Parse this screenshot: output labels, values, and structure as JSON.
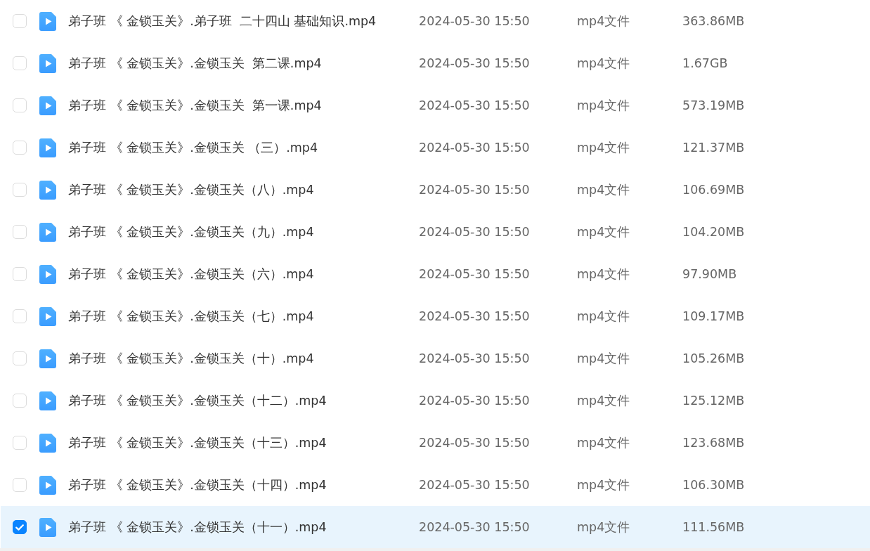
{
  "file_list": {
    "rows": [
      {
        "name": "弟子班 《 金锁玉关》.弟子班  二十四山 基础知识.mp4",
        "modified": "2024-05-30 15:50",
        "type": "mp4文件",
        "size": "363.86MB",
        "selected": false
      },
      {
        "name": "弟子班 《 金锁玉关》.金锁玉关  第二课.mp4",
        "modified": "2024-05-30 15:50",
        "type": "mp4文件",
        "size": "1.67GB",
        "selected": false
      },
      {
        "name": "弟子班 《 金锁玉关》.金锁玉关  第一课.mp4",
        "modified": "2024-05-30 15:50",
        "type": "mp4文件",
        "size": "573.19MB",
        "selected": false
      },
      {
        "name": "弟子班 《 金锁玉关》.金锁玉关 （三）.mp4",
        "modified": "2024-05-30 15:50",
        "type": "mp4文件",
        "size": "121.37MB",
        "selected": false
      },
      {
        "name": "弟子班 《 金锁玉关》.金锁玉关（八）.mp4",
        "modified": "2024-05-30 15:50",
        "type": "mp4文件",
        "size": "106.69MB",
        "selected": false
      },
      {
        "name": "弟子班 《 金锁玉关》.金锁玉关（九）.mp4",
        "modified": "2024-05-30 15:50",
        "type": "mp4文件",
        "size": "104.20MB",
        "selected": false
      },
      {
        "name": "弟子班 《 金锁玉关》.金锁玉关（六）.mp4",
        "modified": "2024-05-30 15:50",
        "type": "mp4文件",
        "size": "97.90MB",
        "selected": false
      },
      {
        "name": "弟子班 《 金锁玉关》.金锁玉关（七）.mp4",
        "modified": "2024-05-30 15:50",
        "type": "mp4文件",
        "size": "109.17MB",
        "selected": false
      },
      {
        "name": "弟子班 《 金锁玉关》.金锁玉关（十）.mp4",
        "modified": "2024-05-30 15:50",
        "type": "mp4文件",
        "size": "105.26MB",
        "selected": false
      },
      {
        "name": "弟子班 《 金锁玉关》.金锁玉关（十二）.mp4",
        "modified": "2024-05-30 15:50",
        "type": "mp4文件",
        "size": "125.12MB",
        "selected": false
      },
      {
        "name": "弟子班 《 金锁玉关》.金锁玉关（十三）.mp4",
        "modified": "2024-05-30 15:50",
        "type": "mp4文件",
        "size": "123.68MB",
        "selected": false
      },
      {
        "name": "弟子班 《 金锁玉关》.金锁玉关（十四）.mp4",
        "modified": "2024-05-30 15:50",
        "type": "mp4文件",
        "size": "106.30MB",
        "selected": false
      },
      {
        "name": "弟子班 《 金锁玉关》.金锁玉关（十一）.mp4",
        "modified": "2024-05-30 15:50",
        "type": "mp4文件",
        "size": "111.56MB",
        "selected": true
      }
    ]
  }
}
